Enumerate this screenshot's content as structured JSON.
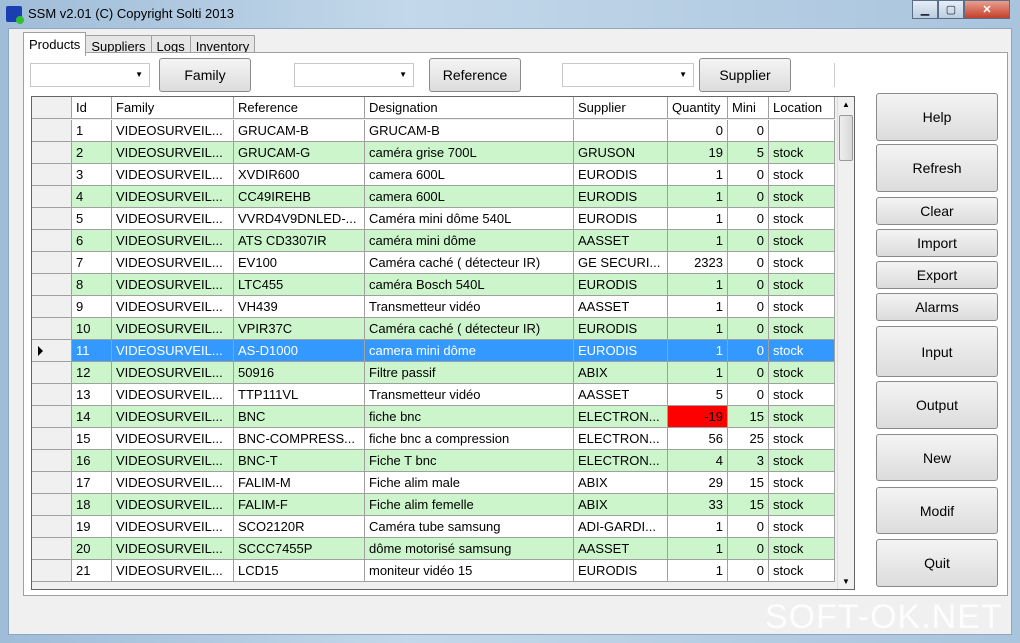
{
  "window": {
    "title": "SSM v2.01 (C) Copyright Solti 2013",
    "minimize": "▁",
    "maximize": "▢",
    "close": "✕"
  },
  "tabs": [
    "Products",
    "Suppliers",
    "Logs",
    "Inventory"
  ],
  "filters": {
    "family_button": "Family",
    "reference_button": "Reference",
    "supplier_button": "Supplier",
    "family_value": "",
    "reference_value": "",
    "supplier_value": ""
  },
  "columns": [
    "Id",
    "Family",
    "Reference",
    "Designation",
    "Supplier",
    "Quantity",
    "Mini",
    "Location"
  ],
  "rows": [
    [
      "1",
      "VIDEOSURVEIL...",
      "GRUCAM-B",
      "GRUCAM-B",
      "",
      "0",
      "0",
      ""
    ],
    [
      "2",
      "VIDEOSURVEIL...",
      "GRUCAM-G",
      "caméra grise  700L",
      "GRUSON",
      "19",
      "5",
      "stock"
    ],
    [
      "3",
      "VIDEOSURVEIL...",
      "XVDIR600",
      "camera 600L",
      "EURODIS",
      "1",
      "0",
      "stock"
    ],
    [
      "4",
      "VIDEOSURVEIL...",
      "CC49IREHB",
      "camera 600L",
      "EURODIS",
      "1",
      "0",
      "stock"
    ],
    [
      "5",
      "VIDEOSURVEIL...",
      "VVRD4V9DNLED-...",
      "Caméra mini dôme 540L",
      "EURODIS",
      "1",
      "0",
      "stock"
    ],
    [
      "6",
      "VIDEOSURVEIL...",
      "ATS CD3307IR",
      "caméra mini dôme",
      "AASSET",
      "1",
      "0",
      "stock"
    ],
    [
      "7",
      "VIDEOSURVEIL...",
      "EV100",
      "Caméra caché ( détecteur IR)",
      "GE SECURI...",
      "2323",
      "0",
      "stock"
    ],
    [
      "8",
      "VIDEOSURVEIL...",
      "LTC455",
      "caméra Bosch 540L",
      "EURODIS",
      "1",
      "0",
      "stock"
    ],
    [
      "9",
      "VIDEOSURVEIL...",
      "VH439",
      "Transmetteur vidéo",
      "AASSET",
      "1",
      "0",
      "stock"
    ],
    [
      "10",
      "VIDEOSURVEIL...",
      "VPIR37C",
      "Caméra caché ( détecteur IR)",
      "EURODIS",
      "1",
      "0",
      "stock"
    ],
    [
      "11",
      "VIDEOSURVEIL...",
      "AS-D1000",
      "camera mini dôme",
      "EURODIS",
      "1",
      "0",
      "stock"
    ],
    [
      "12",
      "VIDEOSURVEIL...",
      "50916",
      "Filtre passif",
      "ABIX",
      "1",
      "0",
      "stock"
    ],
    [
      "13",
      "VIDEOSURVEIL...",
      "TTP111VL",
      "Transmetteur vidéo",
      "AASSET",
      "5",
      "0",
      "stock"
    ],
    [
      "14",
      "VIDEOSURVEIL...",
      "BNC",
      "fiche bnc",
      "ELECTRON...",
      "-19",
      "15",
      "stock"
    ],
    [
      "15",
      "VIDEOSURVEIL...",
      "BNC-COMPRESS...",
      "fiche bnc a compression",
      "ELECTRON...",
      "56",
      "25",
      "stock"
    ],
    [
      "16",
      "VIDEOSURVEIL...",
      "BNC-T",
      "Fiche T bnc",
      "ELECTRON...",
      "4",
      "3",
      "stock"
    ],
    [
      "17",
      "VIDEOSURVEIL...",
      "FALIM-M",
      "Fiche alim male",
      "ABIX",
      "29",
      "15",
      "stock"
    ],
    [
      "18",
      "VIDEOSURVEIL...",
      "FALIM-F",
      "Fiche alim femelle",
      "ABIX",
      "33",
      "15",
      "stock"
    ],
    [
      "19",
      "VIDEOSURVEIL...",
      "SCO2120R",
      "Caméra tube samsung",
      "ADI-GARDI...",
      "1",
      "0",
      "stock"
    ],
    [
      "20",
      "VIDEOSURVEIL...",
      "SCCC7455P",
      "dôme motorisé samsung",
      "AASSET",
      "1",
      "0",
      "stock"
    ],
    [
      "21",
      "VIDEOSURVEIL...",
      "  LCD15",
      "  moniteur vidéo 15",
      "EURODIS",
      "1",
      "0",
      "stock"
    ]
  ],
  "selected_row": "11",
  "colors": {
    "selected": "#3399ff",
    "alt_row": "#ccf5cc",
    "negative": "#ff0000"
  },
  "side_buttons": [
    "Help",
    "Refresh",
    "Clear",
    "Import",
    "Export",
    "Alarms",
    "Input",
    "Output",
    "New",
    "Modif",
    "Quit"
  ],
  "watermark": "SOFT-OK.NET"
}
